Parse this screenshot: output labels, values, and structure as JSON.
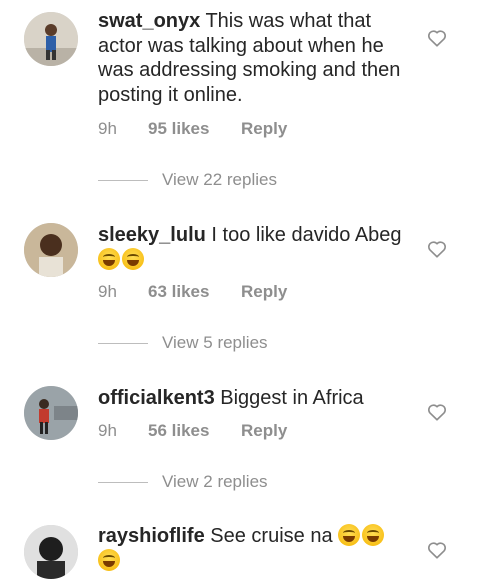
{
  "comments": [
    {
      "username": "swat_onyx",
      "text": "This was what that actor was talking about when he was addressing smoking and then posting it online.",
      "time": "9h",
      "likes": "95 likes",
      "reply": "Reply",
      "view_replies": "View 22 replies",
      "avatar_icon": "user-avatar"
    },
    {
      "username": "sleeky_lulu",
      "text": "I too like davido Abeg",
      "emojis": [
        "laughing-tears-emoji",
        "laughing-tears-emoji"
      ],
      "time": "9h",
      "likes": "63 likes",
      "reply": "Reply",
      "view_replies": "View 5 replies",
      "avatar_icon": "user-avatar"
    },
    {
      "username": "officialkent3",
      "text": "Biggest in Africa",
      "time": "9h",
      "likes": "56 likes",
      "reply": "Reply",
      "view_replies": "View 2 replies",
      "avatar_icon": "user-avatar"
    },
    {
      "username": "rayshioflife",
      "text": "See cruise na",
      "emojis": [
        "laughing-tears-emoji",
        "laughing-tears-emoji",
        "laughing-tears-emoji"
      ],
      "avatar_icon": "user-avatar"
    }
  ],
  "colors": {
    "text": "#262626",
    "meta": "#8e8e8e",
    "divider": "#bdbdbd"
  }
}
